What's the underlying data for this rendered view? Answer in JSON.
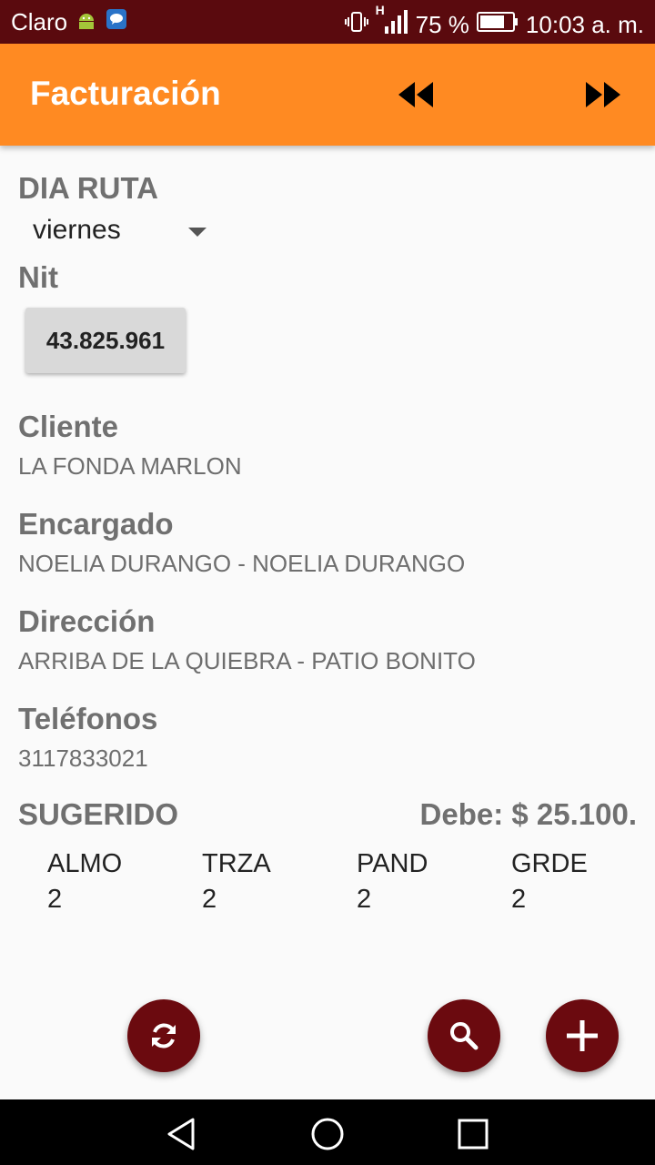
{
  "status_bar": {
    "carrier": "Claro",
    "network": "H",
    "battery": "75 %",
    "time": "10:03 a. m."
  },
  "app_bar": {
    "title": "Facturación",
    "prev_icon": "rewind-icon",
    "next_icon": "fast-forward-icon"
  },
  "form": {
    "dia_ruta_label": "DIA RUTA",
    "dia_ruta_value": "viernes",
    "nit_label": "Nit",
    "nit_value": "43.825.961",
    "cliente_label": "Cliente",
    "cliente_value": "LA FONDA MARLON",
    "encargado_label": "Encargado",
    "encargado_value": "NOELIA DURANGO - NOELIA DURANGO",
    "direccion_label": "Dirección",
    "direccion_value": "ARRIBA DE LA QUIEBRA - PATIO BONITO",
    "telefonos_label": "Teléfonos",
    "telefonos_value": "3117833021"
  },
  "sugerido": {
    "label": "SUGERIDO",
    "debe": "Debe: $ 25.100.",
    "items": [
      {
        "code": "ALMO",
        "qty": "2"
      },
      {
        "code": "TRZA",
        "qty": "2"
      },
      {
        "code": "PAND",
        "qty": "2"
      },
      {
        "code": "GRDE",
        "qty": "2"
      }
    ]
  },
  "fabs": {
    "sync_icon": "sync-icon",
    "search_icon": "search-icon",
    "add_icon": "add-icon"
  },
  "colors": {
    "status_bar": "#5a0a0e",
    "app_bar": "#ff8a22",
    "fab": "#6b0a0f"
  }
}
